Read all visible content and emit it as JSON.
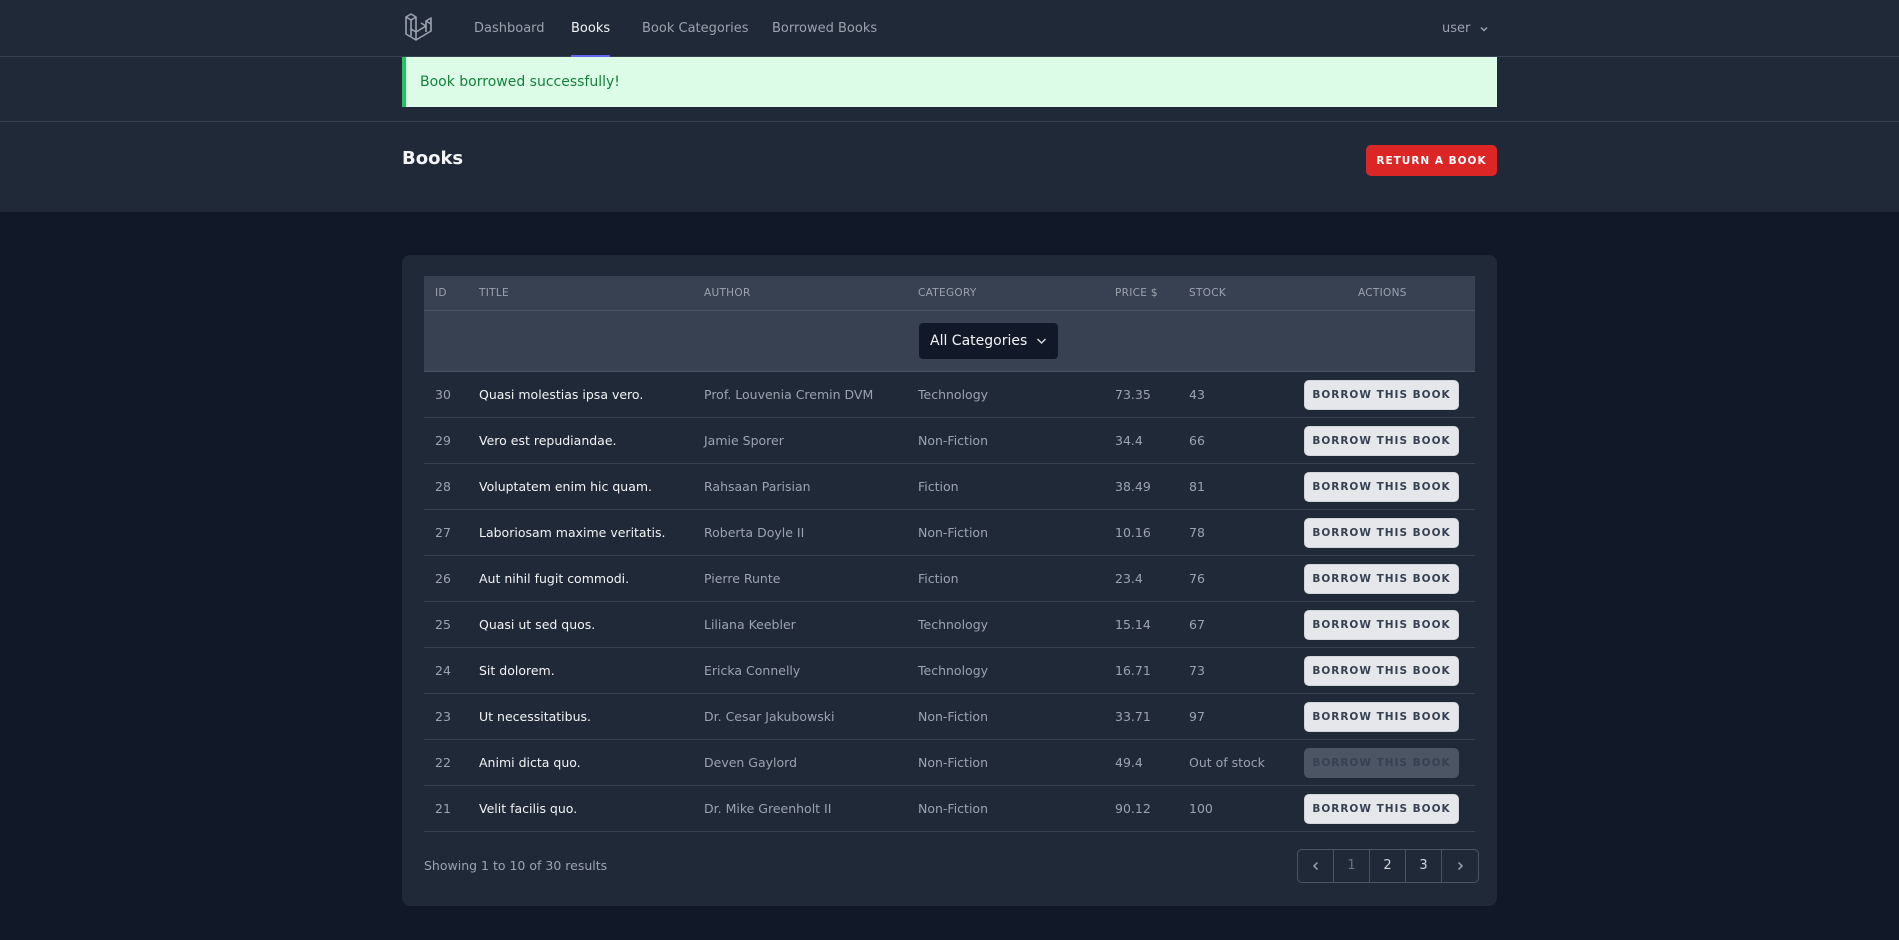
{
  "nav": {
    "links": [
      "Dashboard",
      "Books",
      "Book Categories",
      "Borrowed Books"
    ],
    "active": "Books",
    "user": "user"
  },
  "alert": {
    "message": "Book borrowed successfully!"
  },
  "header": {
    "title": "Books",
    "return_label": "RETURN A BOOK"
  },
  "table": {
    "columns": [
      "ID",
      "TITLE",
      "AUTHOR",
      "CATEGORY",
      "PRICE $",
      "STOCK",
      "ACTIONS"
    ],
    "category_filter": "All Categories",
    "borrow_label": "BORROW THIS BOOK",
    "rows": [
      {
        "id": "30",
        "title": "Quasi molestias ipsa vero.",
        "author": "Prof. Louvenia Cremin DVM",
        "category": "Technology",
        "price": "73.35",
        "stock": "43",
        "available": true
      },
      {
        "id": "29",
        "title": "Vero est repudiandae.",
        "author": "Jamie Sporer",
        "category": "Non-Fiction",
        "price": "34.4",
        "stock": "66",
        "available": true
      },
      {
        "id": "28",
        "title": "Voluptatem enim hic quam.",
        "author": "Rahsaan Parisian",
        "category": "Fiction",
        "price": "38.49",
        "stock": "81",
        "available": true
      },
      {
        "id": "27",
        "title": "Laboriosam maxime veritatis.",
        "author": "Roberta Doyle II",
        "category": "Non-Fiction",
        "price": "10.16",
        "stock": "78",
        "available": true
      },
      {
        "id": "26",
        "title": "Aut nihil fugit commodi.",
        "author": "Pierre Runte",
        "category": "Fiction",
        "price": "23.4",
        "stock": "76",
        "available": true
      },
      {
        "id": "25",
        "title": "Quasi ut sed quos.",
        "author": "Liliana Keebler",
        "category": "Technology",
        "price": "15.14",
        "stock": "67",
        "available": true
      },
      {
        "id": "24",
        "title": "Sit dolorem.",
        "author": "Ericka Connelly",
        "category": "Technology",
        "price": "16.71",
        "stock": "73",
        "available": true
      },
      {
        "id": "23",
        "title": "Ut necessitatibus.",
        "author": "Dr. Cesar Jakubowski",
        "category": "Non-Fiction",
        "price": "33.71",
        "stock": "97",
        "available": true
      },
      {
        "id": "22",
        "title": "Animi dicta quo.",
        "author": "Deven Gaylord",
        "category": "Non-Fiction",
        "price": "49.4",
        "stock": "Out of stock",
        "available": false
      },
      {
        "id": "21",
        "title": "Velit facilis quo.",
        "author": "Dr. Mike Greenholt II",
        "category": "Non-Fiction",
        "price": "90.12",
        "stock": "100",
        "available": true
      }
    ]
  },
  "pagination": {
    "summary": "Showing 1 to 10 of 30 results",
    "pages": [
      "1",
      "2",
      "3"
    ],
    "current": "1"
  }
}
